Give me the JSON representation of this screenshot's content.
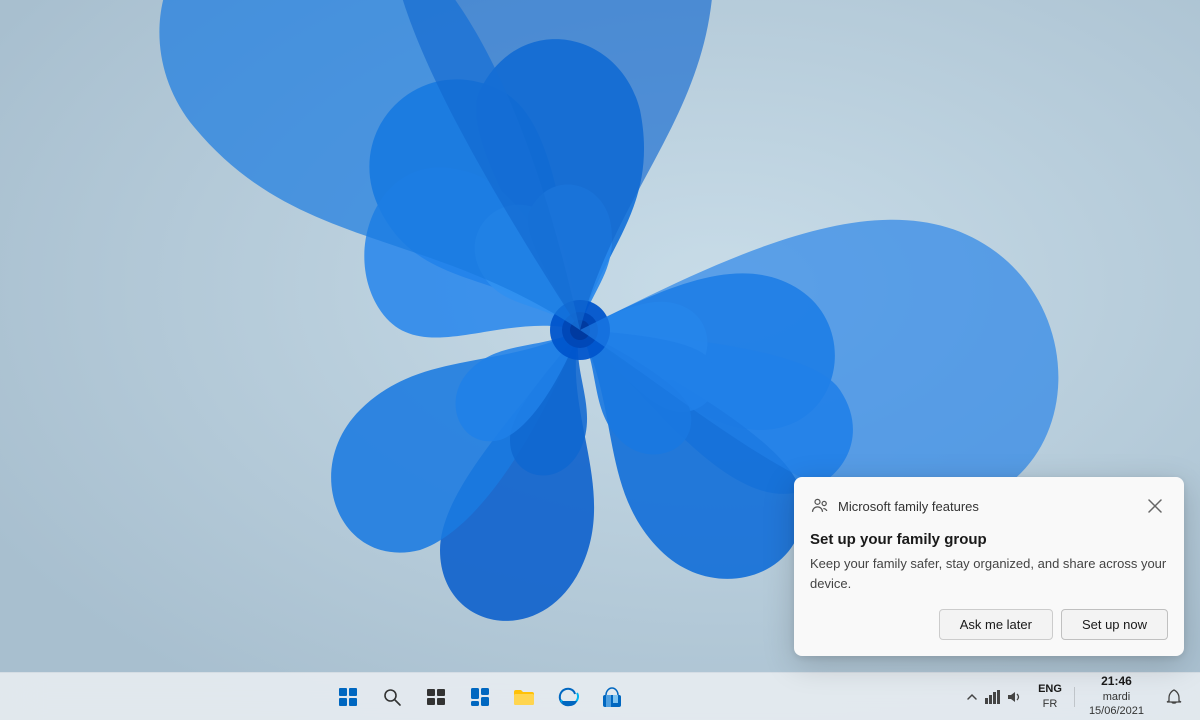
{
  "desktop": {
    "wallpaper_description": "Windows 11 blue flower wallpaper"
  },
  "taskbar": {
    "icons": [
      {
        "name": "start-button",
        "label": "Start",
        "icon": "⊞"
      },
      {
        "name": "search-button",
        "label": "Search",
        "icon": "🔍"
      },
      {
        "name": "task-view-button",
        "label": "Task View",
        "icon": "⧉"
      },
      {
        "name": "widgets-button",
        "label": "Widgets",
        "icon": "▦"
      },
      {
        "name": "file-explorer-button",
        "label": "File Explorer",
        "icon": "📁"
      },
      {
        "name": "edge-button",
        "label": "Microsoft Edge",
        "icon": "🌐"
      },
      {
        "name": "store-button",
        "label": "Microsoft Store",
        "icon": "🛍️"
      }
    ],
    "system_tray": {
      "chevron_label": "Show hidden icons",
      "network_label": "Network",
      "volume_label": "Volume",
      "language": "ENG\nFR"
    },
    "clock": {
      "time": "21:46",
      "day": "mardi",
      "date": "15/06/2021"
    },
    "notification_center_label": "Notification Center"
  },
  "notification": {
    "app_name": "Microsoft family features",
    "title": "Set up your family group",
    "body": "Keep your family safer, stay organized, and share across your device.",
    "button_dismiss": "Ask me later",
    "button_confirm": "Set up now",
    "close_label": "Close"
  }
}
